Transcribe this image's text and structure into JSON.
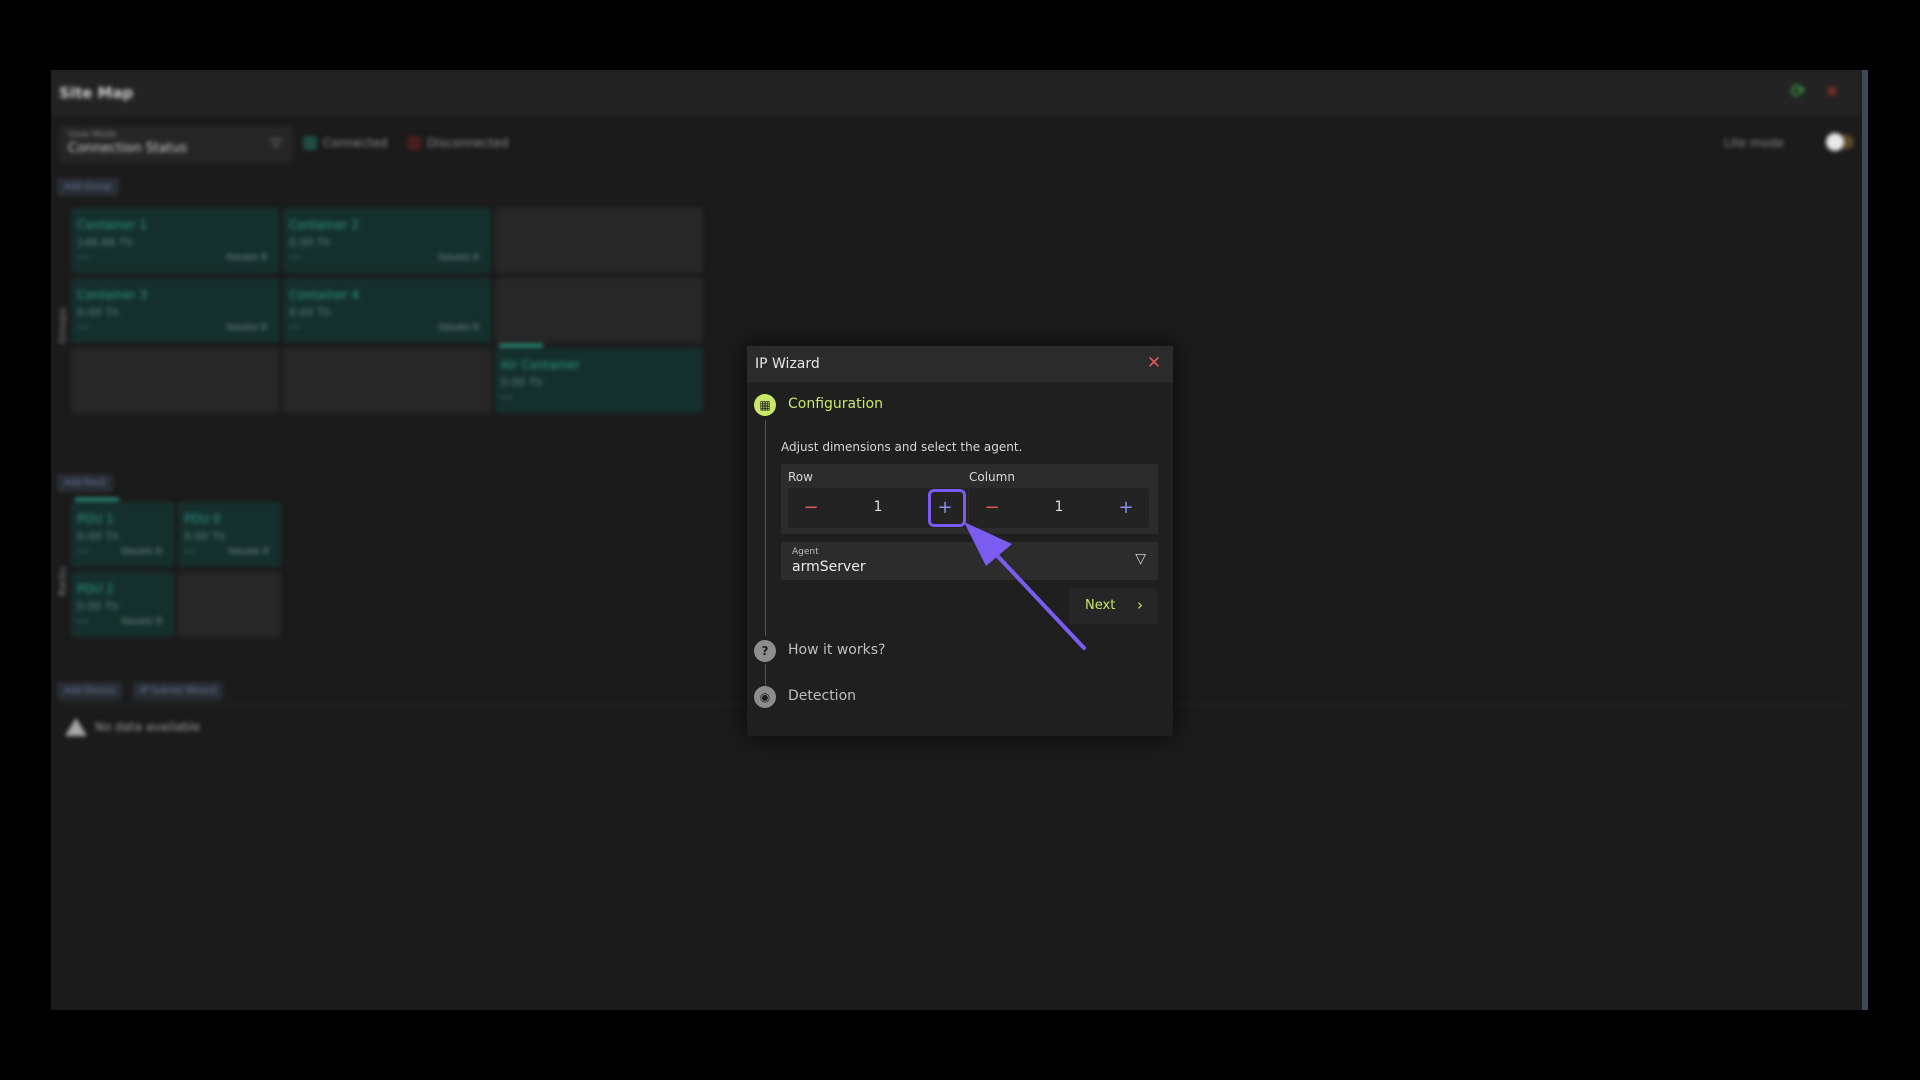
{
  "window": {
    "title": "Site Map"
  },
  "toolbar": {
    "view_mode_label": "View Mode",
    "view_mode_value": "Connection Status",
    "legend": [
      {
        "label": "Connected",
        "color": "#1f4d44"
      },
      {
        "label": "Disconnected",
        "color": "#4a1f1f"
      }
    ],
    "lite_mode_label": "Lite mode",
    "lite_mode_on": true
  },
  "groups": {
    "add_label": "Add Group",
    "side_label": "Groups",
    "cells": [
      {
        "name": "Container 1",
        "rate": "146.66 Th",
        "dash": "---",
        "issues": "Issues 0",
        "kind": "teal"
      },
      {
        "name": "Container 2",
        "rate": "0.00 Th",
        "dash": "---",
        "issues": "Issues 0",
        "kind": "teal"
      },
      {
        "kind": "empty"
      },
      {
        "name": "Container 3",
        "rate": "0.00 Th",
        "dash": "---",
        "issues": "Issues 0",
        "kind": "teal"
      },
      {
        "name": "Container 4",
        "rate": "0.00 Th",
        "dash": "---",
        "issues": "Issues 0",
        "kind": "teal"
      },
      {
        "kind": "empty"
      },
      {
        "kind": "empty"
      },
      {
        "kind": "empty"
      },
      {
        "name": "Air Container",
        "rate": "0.00 Th",
        "dash": "---",
        "kind": "teal"
      }
    ]
  },
  "racks": {
    "add_label": "Add Rack",
    "side_label": "Racks",
    "cells": [
      {
        "name": "PDU 1",
        "rate": "0.00 Th",
        "dash": "---",
        "issues": "Issues 0",
        "kind": "teal"
      },
      {
        "name": "PDU 0",
        "rate": "0.00 Th",
        "dash": "---",
        "issues": "Issues 0",
        "kind": "teal"
      },
      {
        "name": "PDU 2",
        "rate": "0.00 Th",
        "dash": "---",
        "issues": "Issues 0",
        "kind": "teal"
      },
      {
        "kind": "empty"
      }
    ]
  },
  "devices": {
    "add_device_label": "Add Device",
    "ip_wizard_label": "IP Subnet Wizard",
    "no_data": "No data available"
  },
  "dialog": {
    "title": "IP Wizard",
    "steps": [
      {
        "label": "Configuration",
        "state": "active",
        "glyph": "▦"
      },
      {
        "label": "How it works?",
        "state": "idle",
        "glyph": "?"
      },
      {
        "label": "Detection",
        "state": "idle",
        "glyph": "◉"
      }
    ],
    "description": "Adjust dimensions and select the agent.",
    "row": {
      "label": "Row",
      "value": "1"
    },
    "column": {
      "label": "Column",
      "value": "1"
    },
    "agent": {
      "label": "Agent",
      "value": "armServer"
    },
    "next_label": "Next"
  },
  "colors": {
    "accent": "#c9e86a",
    "annotation": "#7b5cf0",
    "danger": "#e05a5a",
    "plus": "#8a8cf0"
  }
}
